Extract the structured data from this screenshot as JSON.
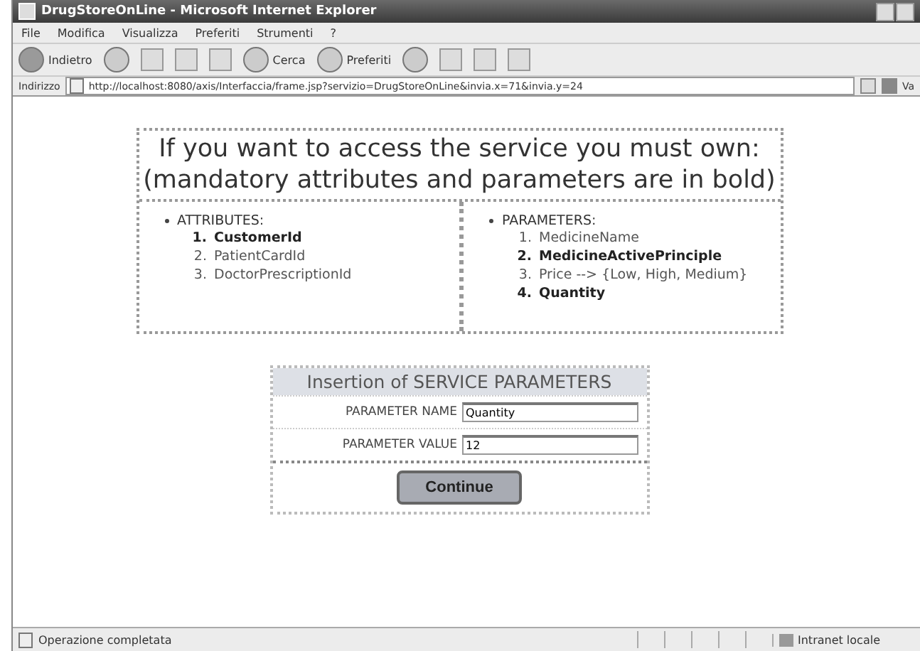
{
  "window": {
    "title": "DrugStoreOnLine - Microsoft Internet Explorer"
  },
  "menu": [
    "File",
    "Modifica",
    "Visualizza",
    "Preferiti",
    "Strumenti",
    "?"
  ],
  "toolbar": {
    "back": "Indietro",
    "search": "Cerca",
    "favorites": "Preferiti"
  },
  "address_bar": {
    "label": "Indirizzo",
    "url": "http://localhost:8080/axis/Interfaccia/frame.jsp?servizio=DrugStoreOnLine&invia.x=71&invia.y=24",
    "go": "Va"
  },
  "heading": [
    "If you want to access the service you must own:",
    "(mandatory attributes and parameters are in bold)"
  ],
  "attributes": {
    "title": "ATTRIBUTES:",
    "items": [
      {
        "number": "1.",
        "text": "CustomerId",
        "mandatory": true
      },
      {
        "number": "2.",
        "text": "PatientCardId",
        "mandatory": false
      },
      {
        "number": "3.",
        "text": "DoctorPrescriptionId",
        "mandatory": false
      }
    ]
  },
  "parameters": {
    "title": "PARAMETERS:",
    "items": [
      {
        "number": "1.",
        "text": "MedicineName",
        "mandatory": false
      },
      {
        "number": "2.",
        "text": "MedicineActivePrinciple",
        "mandatory": true
      },
      {
        "number": "3.",
        "text": "Price --> {Low, High, Medium}",
        "mandatory": false
      },
      {
        "number": "4.",
        "text": "Quantity",
        "mandatory": true
      }
    ]
  },
  "form": {
    "title": "Insertion of SERVICE PARAMETERS",
    "fields": [
      {
        "label": "PARAMETER NAME",
        "value": "Quantity"
      },
      {
        "label": "PARAMETER VALUE",
        "value": "12"
      }
    ],
    "button": "Continue"
  },
  "status_bar": {
    "message": "Operazione completata",
    "zone": "Intranet locale"
  }
}
